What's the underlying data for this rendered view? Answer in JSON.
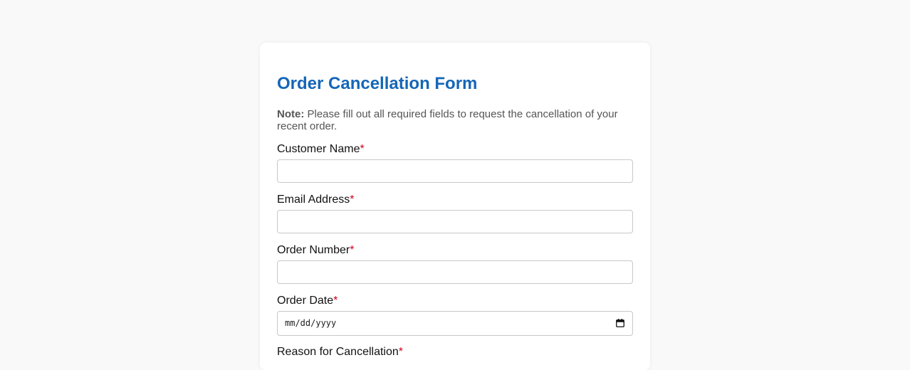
{
  "form": {
    "title": "Order Cancellation Form",
    "note_label": "Note:",
    "note_text": " Please fill out all required fields to request the cancellation of your recent order.",
    "required_marker": "*",
    "fields": [
      {
        "label": "Customer Name",
        "value": "",
        "placeholder": ""
      },
      {
        "label": "Email Address",
        "value": "",
        "placeholder": ""
      },
      {
        "label": "Order Number",
        "value": "",
        "placeholder": ""
      },
      {
        "label": "Order Date",
        "value": "",
        "placeholder": "mm/dd/yyyy"
      },
      {
        "label": "Reason for Cancellation"
      }
    ]
  },
  "colors": {
    "accent": "#1566b7",
    "required": "#d0021b",
    "background": "#f9f9f9",
    "card": "#ffffff"
  },
  "icons": {
    "date_picker": "calendar-icon"
  }
}
